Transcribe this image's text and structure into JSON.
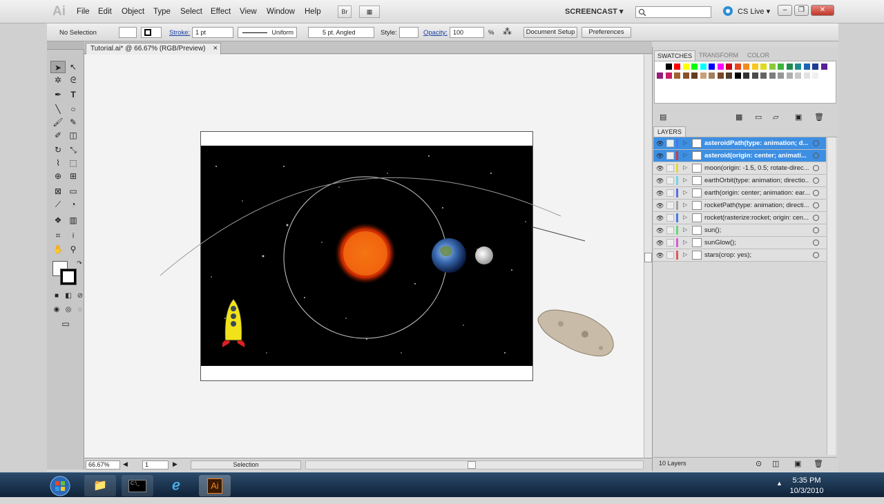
{
  "app": {
    "logo": "Ai"
  },
  "menu": [
    "File",
    "Edit",
    "Object",
    "Type",
    "Select",
    "Effect",
    "View",
    "Window",
    "Help"
  ],
  "menubar_buttons": {
    "bridge": "Br",
    "arrange": "▦"
  },
  "workspace": "SCREENCAST",
  "cslive": "CS Live",
  "window_buttons": {
    "minimize": "–",
    "restore": "❐",
    "close": "✕"
  },
  "control": {
    "selection": "No Selection",
    "stroke_label": "Stroke:",
    "stroke_weight": "1 pt",
    "profile": "Uniform",
    "brush": "5 pt. Angled",
    "style_label": "Style:",
    "opacity_label": "Opacity:",
    "opacity_value": "100",
    "opacity_unit": "%",
    "document_setup": "Document Setup",
    "preferences": "Preferences"
  },
  "doc_tab": {
    "title": "Tutorial.ai* @ 66.67% (RGB/Preview)",
    "close": "×"
  },
  "status": {
    "zoom": "66.67%",
    "artboard": "1",
    "tool": "Selection"
  },
  "panels": {
    "tabs": [
      "SWATCHES",
      "TRANSFORM",
      "COLOR"
    ],
    "layers_tab": "LAYERS",
    "layers_count": "10 Layers"
  },
  "layers": [
    {
      "name": "asteroidPath(type: animation; d...",
      "color": "#4a78e8",
      "selected": true
    },
    {
      "name": "asteroid(origin: center; animati...",
      "color": "#d23a3a",
      "selected": true
    },
    {
      "name": "moon(origin: -1.5, 0.5; rotate-direc...",
      "color": "#e6d83a",
      "selected": false
    },
    {
      "name": "earthOrbit(type: animation; directio...",
      "color": "#6fd8e6",
      "selected": false
    },
    {
      "name": "earth(origin: center; animation: ear...",
      "color": "#5a6ee0",
      "selected": false
    },
    {
      "name": "rocketPath(type: animation; directi...",
      "color": "#a0a0a0",
      "selected": false
    },
    {
      "name": "rocket(rasterize:rocket; origin: cen...",
      "color": "#4a78e8",
      "selected": false
    },
    {
      "name": "sun();",
      "color": "#6ad87a",
      "selected": false
    },
    {
      "name": "sunGlow();",
      "color": "#d85ad8",
      "selected": false
    },
    {
      "name": "stars(crop: yes);",
      "color": "#e05a5a",
      "selected": false
    }
  ],
  "swatch_colors": [
    "#ffffff",
    "#000000",
    "#ff0000",
    "#ffff00",
    "#00ff00",
    "#00ffff",
    "#0000ff",
    "#ff00ff",
    "#c8001e",
    "#e8461e",
    "#f08c1e",
    "#f8c81e",
    "#dcdc1e",
    "#8cc83c",
    "#3cb43c",
    "#1e8c50",
    "#1e8c8c",
    "#1e64b4",
    "#1e3c96",
    "#5a1e96",
    "#961e78",
    "#c81e64",
    "#a06432",
    "#8c5028",
    "#643c1e",
    "#c8a078",
    "#a08060",
    "#784628",
    "#503c28",
    "#000000",
    "#323232",
    "#4b4b4b",
    "#646464",
    "#7d7d7d",
    "#969696",
    "#afafaf",
    "#c8c8c8",
    "#e1e1e1",
    "#f0f0f0"
  ],
  "taskbar": {
    "time": "5:35 PM",
    "date": "10/3/2010",
    "ai_label": "Ai"
  }
}
